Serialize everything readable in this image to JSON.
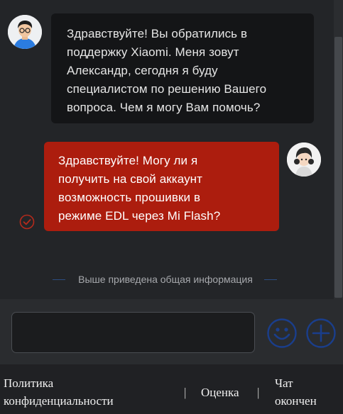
{
  "chat": {
    "agent_message": "Здравствуйте! Вы обратились в\nподдержку Xiaomi. Меня зовут\nАлександр, сегодня я буду\nспециалистом по решению Вашего\nвопроса. Чем я могу Вам помочь?",
    "user_message": "Здравствуйте! Могу ли я\nполучить на свой аккаунт\nвозможность прошивки в\nрежиме EDL через Mi Flash?",
    "divider_text": "Выше приведена общая информация"
  },
  "input": {
    "value": "",
    "placeholder": ""
  },
  "icons": {
    "agent_avatar": "agent-avatar",
    "user_avatar": "user-avatar",
    "sent_status": "check-circle-icon",
    "emoji": "smiley-icon",
    "add": "plus-circle-icon"
  },
  "footer": {
    "privacy_label": "Политика\nконфиденциальности",
    "separator": "|",
    "rate_label": "Оценка",
    "status_label": "Чат\nокончен"
  },
  "colors": {
    "background": "#232528",
    "agent_bubble": "#141517",
    "user_bubble": "#ac1d0e",
    "accent_blue": "#1a3e8c",
    "check_red": "#b52a1c",
    "footer_bg": "#202124"
  }
}
